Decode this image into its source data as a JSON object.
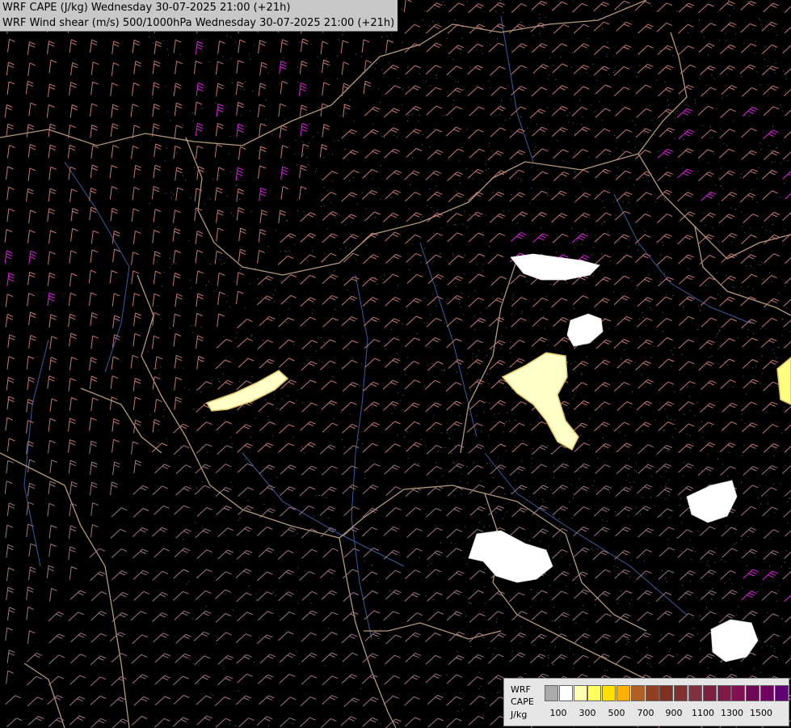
{
  "map": {
    "title_lines": [
      "WRF CAPE (J/kg) Wednesday 30-07-2025 21:00 (+21h)",
      "WRF Wind shear (m/s) 500/1000hPa Wednesday 30-07-2025 21:00 (+21h)"
    ],
    "background_color": "#000000",
    "wind_barb_color": "#c87878",
    "strong_barb_color": "#e020e0",
    "border_color": "#d2b48c",
    "river_color": "#3c5aa0",
    "cape_cells": [
      {
        "name": "cape-cell-northeast",
        "level": 1
      },
      {
        "name": "cape-cell-east-1",
        "level": 1
      },
      {
        "name": "cape-cell-east-2",
        "level": 2
      },
      {
        "name": "cape-cell-center",
        "level": 2
      },
      {
        "name": "cape-cell-southeast",
        "level": 1
      },
      {
        "name": "cape-cell-east-3",
        "level": 1
      },
      {
        "name": "cape-cell-far-southeast",
        "level": 1
      },
      {
        "name": "cape-cell-far-east",
        "level": 3
      }
    ]
  },
  "legend": {
    "title_lines": [
      "WRF",
      "CAPE",
      "J/kg"
    ],
    "colors": [
      "#aaaaaa",
      "#ffffff",
      "#ffffb0",
      "#ffff60",
      "#ffe000",
      "#ffb000",
      "#b06020",
      "#904020",
      "#803020",
      "#803030",
      "#803040",
      "#802040",
      "#801848",
      "#801050",
      "#700858",
      "#700060",
      "#600070"
    ],
    "ticks": [
      "100",
      "300",
      "500",
      "700",
      "900",
      "1100",
      "1300",
      "1500"
    ]
  }
}
